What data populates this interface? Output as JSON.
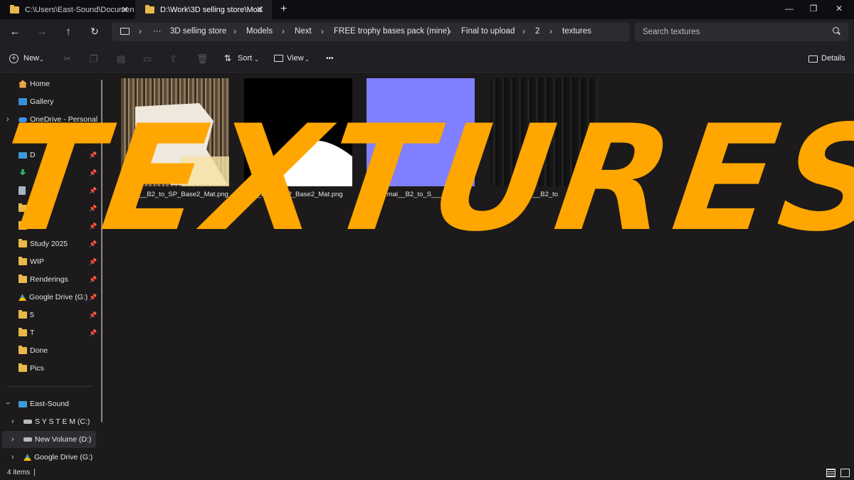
{
  "tabs": [
    {
      "label": "C:\\Users\\East-Sound\\Documen",
      "active": false
    },
    {
      "label": "D:\\Work\\3D selling store\\Mod",
      "active": true
    }
  ],
  "new_tab_label": "+",
  "window_controls": {
    "minimize": "—",
    "restore": "❐",
    "close": "✕"
  },
  "breadcrumb": {
    "ellipsis": "···",
    "items": [
      "3D selling store",
      "Models",
      "Next",
      "FREE trophy bases pack (mine)",
      "Final to upload",
      "2",
      "textures"
    ]
  },
  "search": {
    "placeholder": "Search textures"
  },
  "toolbar": {
    "new_label": "New",
    "sort_label": "Sort",
    "view_label": "View",
    "more_label": "•••",
    "details_label": "Details"
  },
  "sidebar": {
    "items": [
      {
        "label": "Home",
        "icon": "home-icon",
        "pinned": false
      },
      {
        "label": "Gallery",
        "icon": "gallery-icon",
        "pinned": false
      },
      {
        "label": "OneDrive - Personal",
        "icon": "onedrive-icon",
        "pinned": false
      },
      {
        "label": "D",
        "icon": "desktop-icon",
        "pinned": true
      },
      {
        "label": "s",
        "icon": "download-icon",
        "pinned": true
      },
      {
        "label": "ts",
        "icon": "documents-icon",
        "pinned": true
      },
      {
        "label": "",
        "icon": "folder-icon",
        "pinned": true
      },
      {
        "label": "",
        "icon": "folder-icon",
        "pinned": true
      },
      {
        "label": "Study 2025",
        "icon": "folder-icon",
        "pinned": true
      },
      {
        "label": "WIP",
        "icon": "folder-icon",
        "pinned": true
      },
      {
        "label": "Renderings",
        "icon": "folder-icon",
        "pinned": true
      },
      {
        "label": "Google Drive (G:)",
        "icon": "google-drive-icon",
        "pinned": true
      },
      {
        "label": "5",
        "icon": "folder-icon",
        "pinned": true
      },
      {
        "label": "T",
        "icon": "folder-icon",
        "pinned": true
      },
      {
        "label": "Done",
        "icon": "folder-icon",
        "pinned": false
      },
      {
        "label": "Pics",
        "icon": "folder-icon",
        "pinned": false
      }
    ],
    "this_pc": {
      "label": "East-Sound",
      "drives": [
        "S Y S T E M (C:)",
        "New Volume (D:)",
        "Google Drive (G:)"
      ]
    }
  },
  "files": [
    {
      "name": "Color__B2_to_SP_Base2_Mat.png",
      "visible_name": "Color__B2_to_SP_Base2_Mat.png"
    },
    {
      "name": "___B2_to_SP_Base2_Mat.png",
      "visible_name": "__B2_to_SP_Base2_Mat.png"
    },
    {
      "name": "Normal__B2_to_SP_Base2_Mat.png",
      "visible_name": "Normal__B2_to_S____at.png"
    },
    {
      "name": "s__B2_to",
      "visible_name": "s__B2_to"
    }
  ],
  "status": {
    "count": "4 items"
  },
  "overlay_text": "TEXTURES",
  "colors": {
    "overlay": "#ffa600",
    "folder": "#e9b84a",
    "normal_map": "#7f7fff"
  }
}
